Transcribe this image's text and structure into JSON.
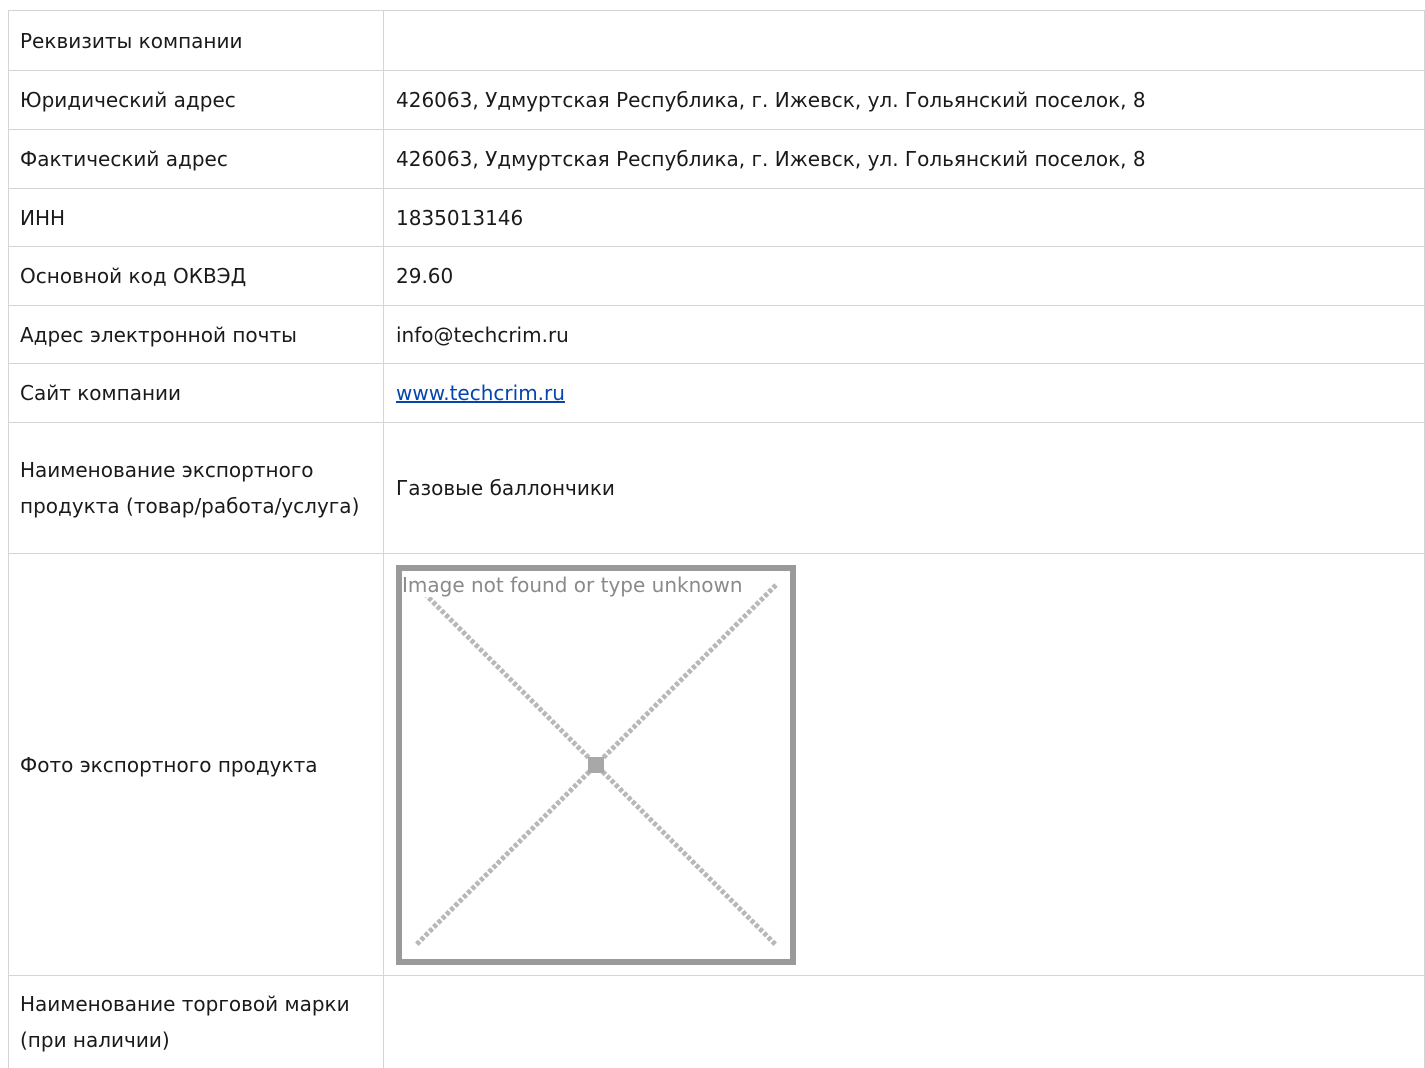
{
  "rows": [
    {
      "label": "Реквизиты компании",
      "value": ""
    },
    {
      "label": "Юридический адрес",
      "value": "426063, Удмуртская Республика, г. Ижевск, ул. Гольянский поселок, 8"
    },
    {
      "label": "Фактический адрес",
      "value": "426063, Удмуртская Республика, г. Ижевск, ул. Гольянский поселок, 8"
    },
    {
      "label": "ИНН",
      "value": "1835013146"
    },
    {
      "label": "Основной код ОКВЭД",
      "value": "29.60"
    },
    {
      "label": "Адрес электронной почты",
      "value": "info@techcrim.ru"
    },
    {
      "label": "Сайт компании",
      "value": "www.techcrim.ru"
    },
    {
      "label": "Наименование экспортного продукта (товар/работа/услуга)",
      "value": "Газовые баллончики"
    },
    {
      "label": "Фото экспортного продукта",
      "image_alt": "Image not found or type unknown"
    },
    {
      "label": "Наименование торговой марки (при наличии)",
      "value": ""
    }
  ],
  "colors": {
    "border": "#d4d4d4",
    "link": "#0645ad",
    "placeholder_frame": "#9a9a9a"
  }
}
